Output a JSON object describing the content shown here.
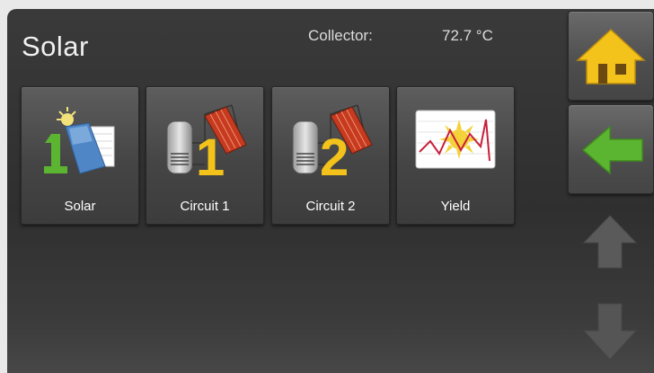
{
  "header": {
    "title": "Solar",
    "collector_label": "Collector:",
    "collector_value": "72.7 °C"
  },
  "tiles": [
    {
      "label": "Solar",
      "icon": "solar-panel-icon"
    },
    {
      "label": "Circuit 1",
      "icon": "tank-circuit-1-icon"
    },
    {
      "label": "Circuit 2",
      "icon": "tank-circuit-2-icon"
    },
    {
      "label": "Yield",
      "icon": "yield-chart-icon"
    }
  ],
  "side_nav": {
    "home_icon": "home-icon",
    "back_icon": "back-arrow-icon",
    "up_icon": "up-arrow-icon",
    "down_icon": "down-arrow-icon"
  },
  "colors": {
    "accent_yellow": "#f3c21b",
    "back_green": "#5cb531",
    "background": "#333333"
  }
}
